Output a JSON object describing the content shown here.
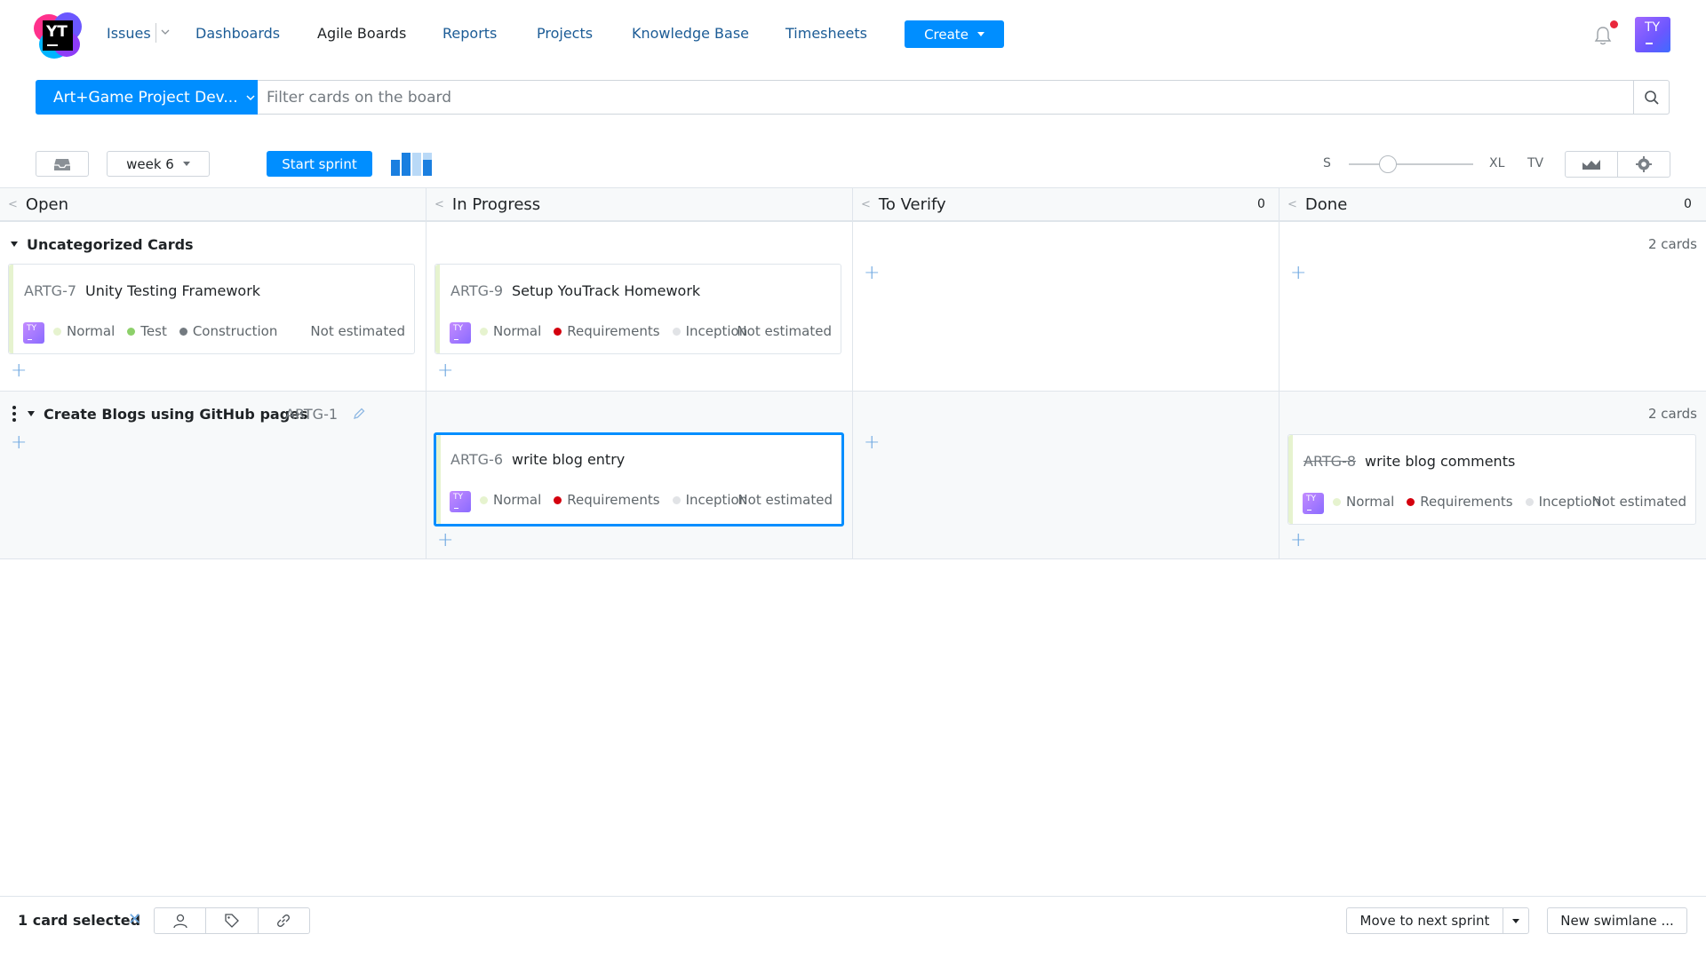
{
  "header": {
    "logo_text": "YT",
    "nav": [
      {
        "label": "Issues"
      },
      {
        "label": "Dashboards"
      },
      {
        "label": "Agile Boards"
      },
      {
        "label": "Reports"
      },
      {
        "label": "Projects"
      },
      {
        "label": "Knowledge Base"
      },
      {
        "label": "Timesheets"
      }
    ],
    "create_label": "Create",
    "user_initials": "TY"
  },
  "search": {
    "board_name": "Art+Game Project Dev...",
    "placeholder": "Filter cards on the board",
    "value": ""
  },
  "toolbar": {
    "sprint_name": "week 6",
    "start_sprint_label": "Start sprint",
    "size_min": "S",
    "size_max": "XL",
    "tv_label": "TV",
    "card_size_level": 0.25
  },
  "columns": [
    {
      "name": "Open",
      "count": ""
    },
    {
      "name": "In Progress",
      "count": ""
    },
    {
      "name": "To Verify",
      "count": "0"
    },
    {
      "name": "Done",
      "count": "0"
    }
  ],
  "swimlanes": [
    {
      "title": "Uncategorized Cards",
      "count_label": "2 cards",
      "cards": [
        {
          "id": "ARTG-7",
          "title": "Unity Testing Framework",
          "avatar": "TY",
          "priority": "Normal",
          "type": "Test",
          "stage": "Construction",
          "estimate": "Not estimated",
          "resolved": false,
          "colors": {
            "priority": "#e6f3cf",
            "type": "#8dd06a",
            "stage": "#737a80"
          }
        },
        {
          "id": "ARTG-9",
          "title": "Setup YouTrack Homework",
          "avatar": "TY",
          "priority": "Normal",
          "type": "Requirements",
          "stage": "Inception",
          "estimate": "Not estimated",
          "resolved": false,
          "colors": {
            "priority": "#e6f3cf",
            "type": "#d4000e",
            "stage": "#e1e3e6"
          }
        }
      ]
    },
    {
      "title": "Create Blogs using GitHub pages",
      "issue_id": "ARTG-1",
      "count_label": "2 cards",
      "cards": [
        {
          "id": "ARTG-6",
          "title": "write blog entry",
          "avatar": "TY",
          "priority": "Normal",
          "type": "Requirements",
          "stage": "Inception",
          "estimate": "Not estimated",
          "resolved": false,
          "selected": true,
          "colors": {
            "priority": "#e6f3cf",
            "type": "#d4000e",
            "stage": "#e1e3e6"
          }
        },
        {
          "id": "ARTG-8",
          "title": "write blog comments",
          "avatar": "TY",
          "priority": "Normal",
          "type": "Requirements",
          "stage": "Inception",
          "estimate": "Not estimated",
          "resolved": true,
          "colors": {
            "priority": "#e6f3cf",
            "type": "#d4000e",
            "stage": "#e1e3e6"
          }
        }
      ]
    }
  ],
  "footer": {
    "selection_label": "1 card selected",
    "move_label": "Move to next sprint",
    "new_swimlane_label": "New swimlane ..."
  },
  "colors": {
    "accent": "#008eff",
    "link": "#1c5c96",
    "notification": "#e9283c"
  }
}
